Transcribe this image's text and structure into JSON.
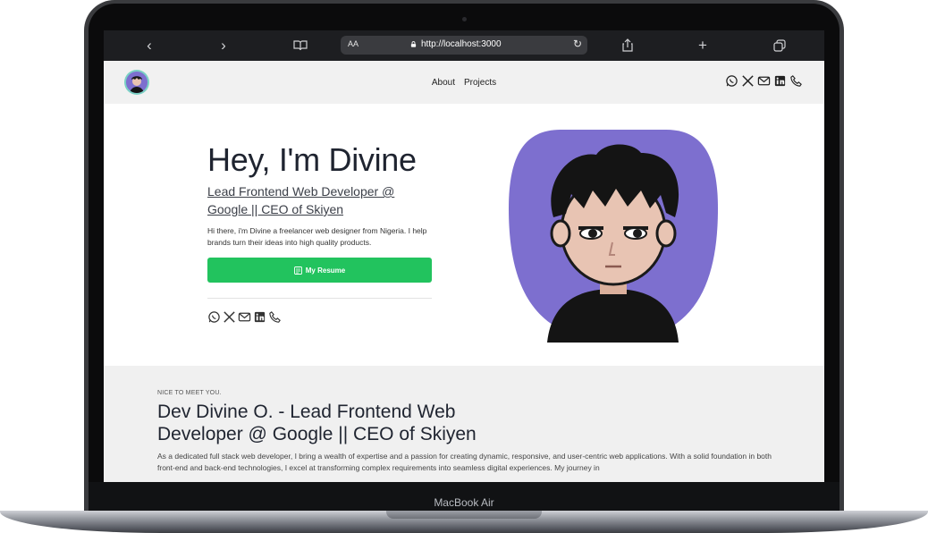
{
  "device": {
    "brand_label": "MacBook Air"
  },
  "browser": {
    "back_icon": "chevron-left-icon",
    "forward_icon": "chevron-right-icon",
    "reader_icon": "book-icon",
    "aa_label": "AA",
    "url": "http://localhost:3000",
    "reload_icon": "reload-icon",
    "share_icon": "share-icon",
    "new_tab_icon": "plus-icon",
    "tabs_icon": "tabs-icon"
  },
  "header": {
    "nav": [
      {
        "label": "About"
      },
      {
        "label": "Projects"
      }
    ],
    "social_icons": [
      "whatsapp-icon",
      "x-icon",
      "mail-icon",
      "linkedin-icon",
      "phone-icon"
    ]
  },
  "hero": {
    "title": "Hey, I'm Divine",
    "role": "Lead Frontend Web Developer @ Google || CEO of Skiyen",
    "intro": "Hi there, i'm Divine a freelancer web designer from Nigeria. I help brands turn their ideas into high quality products.",
    "resume_label": "My Resume",
    "resume_color": "#22c35e",
    "portrait_bg": "#7d6fcf"
  },
  "about": {
    "kicker": "NICE TO MEET YOU.",
    "heading": "Dev Divine O. - Lead Frontend Web Developer @ Google || CEO of Skiyen",
    "bio": "As a dedicated full stack web developer, I bring a wealth of expertise and a passion for creating dynamic, responsive, and user-centric web applications. With a solid foundation in both front-end and back-end technologies, I excel at transforming complex requirements into seamless digital experiences. My journey in"
  }
}
